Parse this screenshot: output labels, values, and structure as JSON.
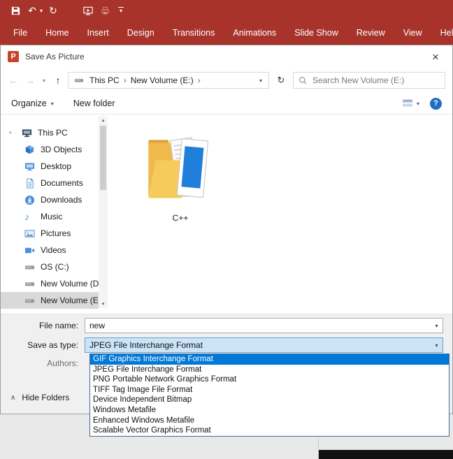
{
  "colors": {
    "ribbon_red": "#A8332B",
    "selection_blue": "#0078D7",
    "combobox_highlight": "#CBE4F7",
    "sidebar_selected": "#D9D9D9",
    "help_blue": "#1E6FC0",
    "folder_yellow": "#EFB94C",
    "accent_blue": "#4A90D9"
  },
  "icons": {
    "undo": "↶",
    "redo": "↻",
    "refresh": "↻",
    "back": "←",
    "forward": "→",
    "up": "↑",
    "caret_down": "▾",
    "crumb_sep": "›",
    "close": "×",
    "help": "?",
    "chevron_up": "∧",
    "scroll_up": "▴",
    "scroll_down": "▾",
    "music_note": "♪",
    "powerpoint": "P"
  },
  "ribbon": {
    "tabs": [
      "File",
      "Home",
      "Insert",
      "Design",
      "Transitions",
      "Animations",
      "Slide Show",
      "Review",
      "View",
      "Help"
    ]
  },
  "dialog": {
    "title": "Save As Picture",
    "nav": {
      "breadcrumb": [
        "This PC",
        "New Volume (E:)"
      ],
      "search_placeholder": "Search New Volume (E:)"
    },
    "toolbar": {
      "organize": "Organize",
      "new_folder": "New folder"
    },
    "sidebar": [
      {
        "label": "This PC",
        "icon": "computer-icon"
      },
      {
        "label": "3D Objects",
        "icon": "cube-icon"
      },
      {
        "label": "Desktop",
        "icon": "desktop-icon"
      },
      {
        "label": "Documents",
        "icon": "document-icon"
      },
      {
        "label": "Downloads",
        "icon": "download-icon"
      },
      {
        "label": "Music",
        "icon": "music-note-icon"
      },
      {
        "label": "Pictures",
        "icon": "picture-icon"
      },
      {
        "label": "Videos",
        "icon": "video-icon"
      },
      {
        "label": "OS (C:)",
        "icon": "drive-icon"
      },
      {
        "label": "New Volume (D:",
        "icon": "drive-icon"
      },
      {
        "label": "New Volume (E:)",
        "icon": "drive-icon",
        "selected": true
      }
    ],
    "files": [
      {
        "name": "C++",
        "icon": "folder-with-documents-icon"
      }
    ],
    "file_name_label": "File name:",
    "file_name_value": "new",
    "save_type_label": "Save as type:",
    "save_type_value": "JPEG File Interchange Format",
    "authors_label": "Authors:",
    "hide_folders_label": "Hide Folders",
    "save_type_options": [
      "GIF Graphics Interchange Format",
      "JPEG File Interchange Format",
      "PNG Portable Network Graphics Format",
      "TIFF Tag Image File Format",
      "Device Independent Bitmap",
      "Windows Metafile",
      "Enhanced Windows Metafile",
      "Scalable Vector Graphics Format"
    ],
    "save_type_selected": "GIF Graphics Interchange Format"
  }
}
